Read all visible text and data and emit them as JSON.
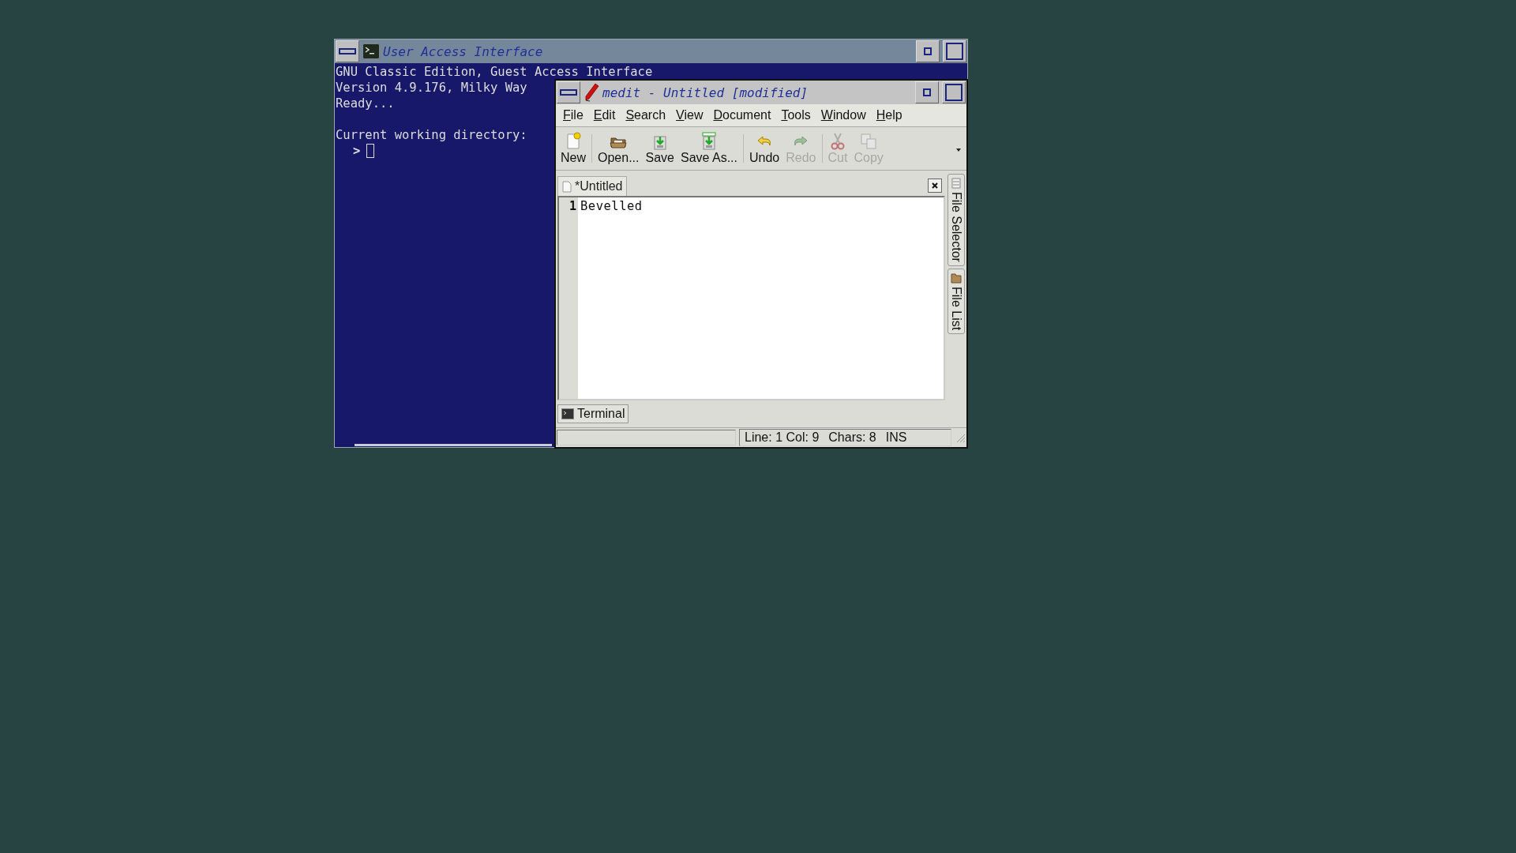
{
  "terminal_window": {
    "title": "User Access Interface",
    "paragraphs": [
      [
        "GNU Classic Edition, Guest Access Interface",
        "Version 4.9.176, Milky Way",
        "Ready..."
      ],
      [
        "Current working directory:"
      ]
    ],
    "prompt": ">"
  },
  "editor_window": {
    "title": "medit - Untitled [modified]",
    "menu": [
      "File",
      "Edit",
      "Search",
      "View",
      "Document",
      "Tools",
      "Window",
      "Help"
    ],
    "toolbar": [
      [
        {
          "label": "New",
          "kind": "new",
          "disabled": false
        }
      ],
      [
        {
          "label": "Open...",
          "kind": "open",
          "disabled": false
        },
        {
          "label": "Save",
          "kind": "save",
          "disabled": false
        },
        {
          "label": "Save As...",
          "kind": "saveas",
          "disabled": false
        }
      ],
      [
        {
          "label": "Undo",
          "kind": "undo",
          "disabled": false
        },
        {
          "label": "Redo",
          "kind": "redo",
          "disabled": true
        }
      ],
      [
        {
          "label": "Cut",
          "kind": "cut",
          "disabled": true
        },
        {
          "label": "Copy",
          "kind": "copy",
          "disabled": true
        }
      ]
    ],
    "tabs": [
      {
        "label": "*Untitled",
        "selected": true
      }
    ],
    "lines": [
      {
        "number": "1",
        "text": "Bevelled"
      }
    ],
    "side_tabs": [
      {
        "label": "File Selector",
        "kind": "selector"
      },
      {
        "label": "File List",
        "kind": "list"
      }
    ],
    "bottom_panel": {
      "label": "Terminal"
    },
    "status_bar": {
      "position": "Line: 1 Col: 9",
      "chars": "Chars: 8",
      "mode": "INS"
    }
  }
}
